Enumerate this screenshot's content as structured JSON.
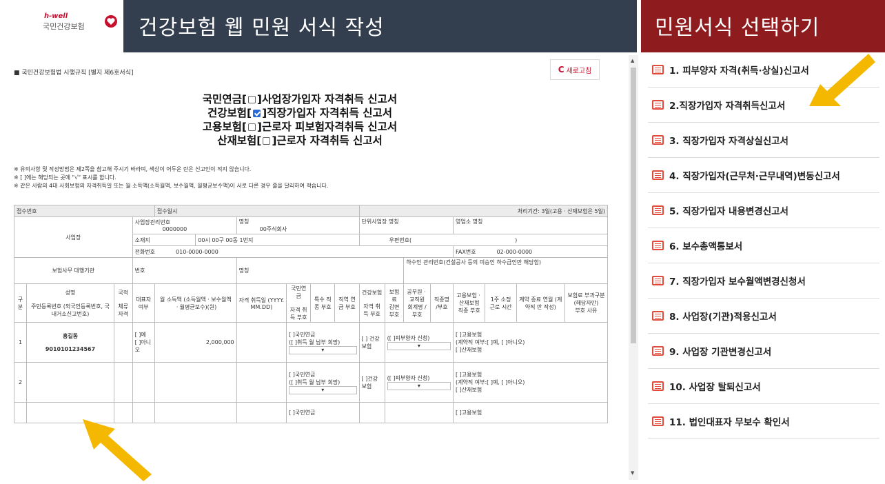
{
  "logo": {
    "en": "h-well",
    "ko": "국민건강보험"
  },
  "header": {
    "title": "건강보험 웹 민원 서식 작성",
    "side_title": "민원서식 선택하기"
  },
  "form": {
    "law": "■ 국민건강보험법 시행규칙 [별지 제6호서식]",
    "refresh": "새로고침",
    "titles": [
      {
        "prefix": "국민연금[",
        "suffix": "]사업장가입자 자격취득 신고서",
        "checked": false
      },
      {
        "prefix": "건강보험[",
        "suffix": "]직장가입자 자격취득 신고서",
        "checked": true
      },
      {
        "prefix": "고용보험[",
        "suffix": "]근로자 피보험자격취득 신고서",
        "checked": false
      },
      {
        "prefix": "산재보험[",
        "suffix": "]근로자 자격취득 신고서",
        "checked": false
      }
    ],
    "notes": [
      "※ 유의사항 및 작성방법은 제2쪽을 참고해 주시기 바라며, 색상이 어두운 란은 신고인이 적지 않습니다.",
      "※ [ ]에는 해당되는 곳에 \"√\" 표시를 합니다.",
      "※ 같은 사람의 4대 사회보험의 자격취득일 또는 월 소득액(소득월액, 보수월액, 월평균보수액)이 서로 다른 경우 줄을 달리하여 적습니다."
    ],
    "row1": {
      "receipt": "접수번호",
      "date": "접수일시",
      "period": "처리기간: 3일(고용ㆍ산재보험은 5일)"
    },
    "biz": {
      "label": "사업장",
      "mgmt_label": "사업장관리번호",
      "mgmt_value": "0000000",
      "name_label": "명칭",
      "name_value": "00주식회사",
      "unit_label": "단위사업장 명칭",
      "branch_label": "영업소 명칭",
      "addr_label": "소재지",
      "addr_value": "00시 00구 00동 1번지",
      "zip_label": "우편번호(",
      "zip_close": ")",
      "phone_label": "전화번호",
      "phone_value": "010-0000-0000",
      "fax_label": "FAX번호",
      "fax_value": "02-000-0000"
    },
    "agent": {
      "label": "보험사무 대행기관",
      "no": "번호",
      "name": "명칭",
      "note": "하수인 관리번호(건설공사 등의 미승인 하수급인만 해당함)"
    },
    "cols": {
      "row_no": "구분",
      "name": "성명",
      "nat": "국적",
      "resid": "주민등록번호 (외국인등록번호, 국내거소신고번호)",
      "stay": "체류 자격",
      "rep": "대표자 여부",
      "income": "월 소득액 (소득월액ㆍ보수월액 ㆍ월평균보수)(원)",
      "acq_date": "자격 취득일 (YYYY. MM.DD)",
      "np": "국민연금",
      "np_acq": "자격 취득 부호",
      "np_job": "특수 직종 부호",
      "np_pay": "직역 연금 부호",
      "hi": "건강보험",
      "hi_acq": "자격 취득 부호",
      "hi_ins": "보험료",
      "hi_red": "감면 부호",
      "hi_gov": "공무원ㆍ교직원",
      "hi_acct": "회계명 /부호",
      "hi_pos": "직종명 /부호",
      "ei": "고용보험ㆍ산재보험",
      "ei_job": "직종 부호",
      "ei_hours": "1주 소정 근로 시간",
      "ei_contract": "계약 종료 연월 (계약직 만 작성)",
      "ei_prem": "보험료 부과구분 (해당자만)",
      "ei_code": "부호",
      "ei_reason": "사유"
    },
    "person1": {
      "no": "1",
      "name": "홍길동",
      "resid": "9010101234567",
      "yes": "[ ]예",
      "no_label": "[ ]아니오",
      "income": "2,000,000",
      "np_chk": "[ ]국민연금",
      "np_month": "([ ]취득 월 납부 희망)",
      "hi_chk": "[ ] 건강보험",
      "hi_dep": "([ ]피부양자 신청)",
      "ei_chk": "[ ]고용보험",
      "ei_contract": "(계약직 여부:[ ]예, [ ]아니오)",
      "ia_chk": "[ ]산재보험"
    },
    "person2": {
      "no": "2",
      "np_chk": "[ ]국민연금",
      "np_month": "([ ]취득 월 납부 희망)",
      "hi_chk": "[ ]건강보험",
      "hi_dep": "([ ]피부양자 신청)",
      "ei_chk": "[ ]고용보험",
      "ei_contract": "(계약직 여부:[ ]예, [ ]아니오)",
      "ia_chk": "[ ]산재보험"
    },
    "person3": {
      "np_chk": "[ ]국민연금",
      "ei_chk": "[ ]고용보험"
    }
  },
  "menu": [
    "1. 피부양자 자격(취득·상실)신고서",
    "2.직장가입자 자격취득신고서",
    "3. 직장가입자 자격상실신고서",
    "4. 직장가입자(근무처·근무내역)변동신고서",
    "5. 직장가입자 내용변경신고서",
    "6. 보수총액통보서",
    "7. 직장가입자 보수월액변경신청서",
    "8. 사업장(기관)적용신고서",
    "9. 사업장 기관변경신고서",
    "10. 사업장 탈퇴신고서",
    "11. 법인대표자 무보수 확인서"
  ],
  "colors": {
    "header_bg": "#333e4e",
    "side_header_bg": "#8e1b1e",
    "arrow": "#f5b800",
    "icon": "#e24a3b"
  }
}
